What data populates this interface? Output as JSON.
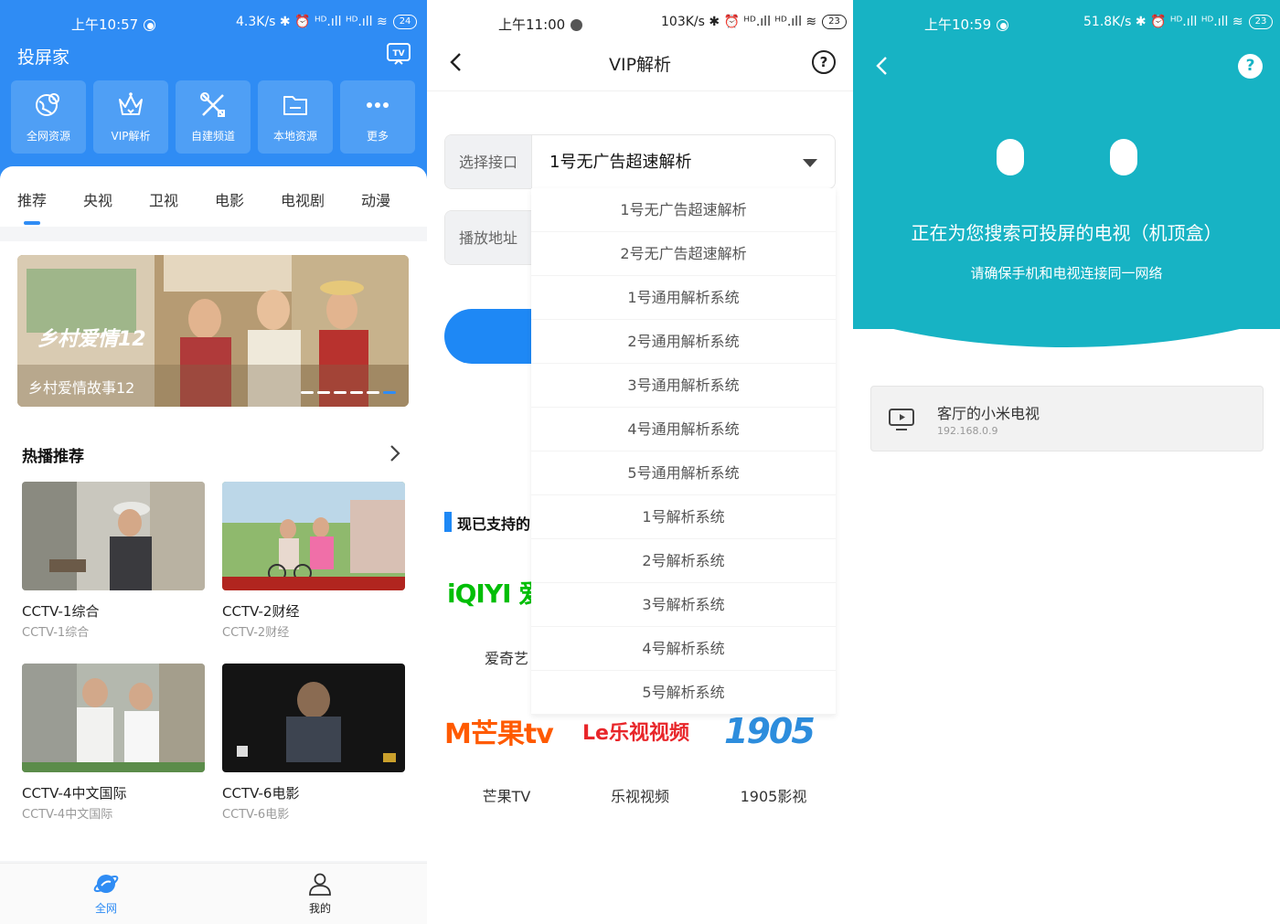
{
  "status_bars": [
    {
      "time": "上午10:57",
      "info": "4.3K/s ✱ ⏰ ᴴᴰ.ıll ᴴᴰ.ıll ≋",
      "battery": "24"
    },
    {
      "time": "上午11:00",
      "info": "103K/s ✱ ⏰ ᴴᴰ.ıll ᴴᴰ.ıll ≋",
      "battery": "23"
    },
    {
      "time": "上午10:59",
      "info": "51.8K/s ✱ ⏰ ᴴᴰ.ıll ᴴᴰ.ıll ≋",
      "battery": "23"
    }
  ],
  "home": {
    "app_title": "投屏家",
    "tiles": [
      {
        "label": "全网资源",
        "icon": "globe-pin-icon"
      },
      {
        "label": "VIP解析",
        "icon": "crown-icon"
      },
      {
        "label": "自建频道",
        "icon": "tools-icon"
      },
      {
        "label": "本地资源",
        "icon": "folder-icon"
      },
      {
        "label": "更多",
        "icon": "more-icon"
      }
    ],
    "tabs": [
      "推荐",
      "央视",
      "卫视",
      "电影",
      "电视剧",
      "动漫"
    ],
    "active_tab": 0,
    "banner": {
      "logo_text": "乡村爱情12",
      "caption": "乡村爱情故事12",
      "dot_count": 6,
      "active_dot": 5
    },
    "section_title": "热播推荐",
    "cards": [
      {
        "title": "CCTV-1综合",
        "subtitle": "CCTV-1综合"
      },
      {
        "title": "CCTV-2财经",
        "subtitle": "CCTV-2财经"
      },
      {
        "title": "CCTV-4中文国际",
        "subtitle": "CCTV-4中文国际"
      },
      {
        "title": "CCTV-6电影",
        "subtitle": "CCTV-6电影"
      }
    ],
    "nav": [
      {
        "label": "全网",
        "active": true
      },
      {
        "label": "我的",
        "active": false
      }
    ],
    "colors": {
      "primary": "#2f8cf4"
    }
  },
  "vip": {
    "title": "VIP解析",
    "help": "?",
    "interface_label": "选择接口",
    "interface_value": "1号无广告超速解析",
    "address_label": "播放地址",
    "section_title": "现已支持的",
    "platforms_row1": [
      {
        "label": "爱奇艺",
        "logo": "iQIYI 爱奇"
      }
    ],
    "platforms_row2": [
      {
        "label": "芒果TV",
        "logo": "M芒果tv"
      },
      {
        "label": "乐视视频",
        "logo": "Le乐视视频"
      },
      {
        "label": "1905影视",
        "logo": "1905"
      }
    ],
    "dropdown_options": [
      "1号无广告超速解析",
      "2号无广告超速解析",
      "1号通用解析系统",
      "2号通用解析系统",
      "3号通用解析系统",
      "4号通用解析系统",
      "5号通用解析系统",
      "1号解析系统",
      "2号解析系统",
      "3号解析系统",
      "4号解析系统",
      "5号解析系统"
    ],
    "colors": {
      "primary": "#1e88f5"
    }
  },
  "cast": {
    "title": "正在为您搜索可投屏的电视（机顶盒）",
    "subtitle": "请确保手机和电视连接同一网络",
    "help": "?",
    "device_name": "客厅的小米电视",
    "device_ip": "192.168.0.9",
    "colors": {
      "hero": "#17b3c4"
    }
  }
}
